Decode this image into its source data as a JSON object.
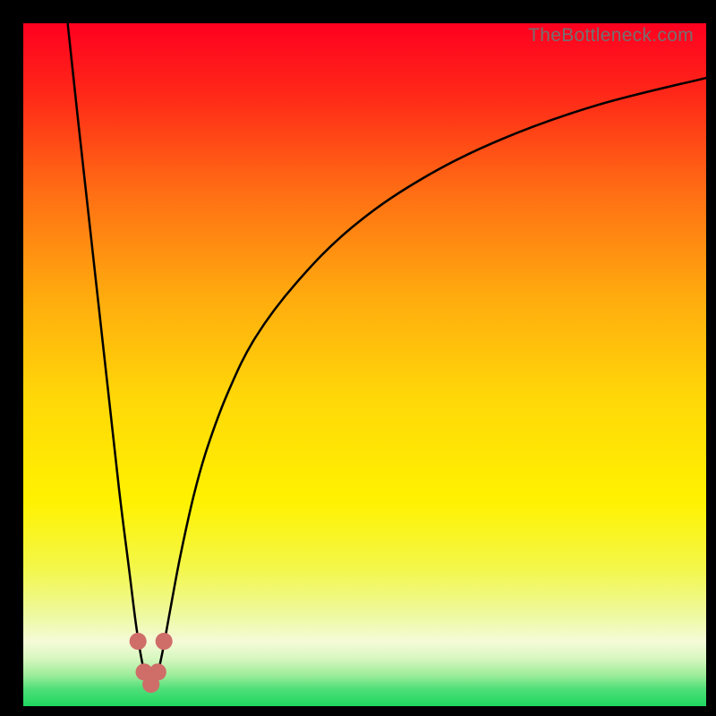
{
  "watermark": "TheBottleneck.com",
  "chart_data": {
    "type": "line",
    "title": "",
    "xlabel": "",
    "ylabel": "",
    "xlim": [
      0,
      100
    ],
    "ylim": [
      0,
      100
    ],
    "grid": false,
    "legend": false,
    "background": "rainbow-vertical-gradient",
    "gradient_stops": [
      {
        "pos": 0.0,
        "color": "#ff0020"
      },
      {
        "pos": 0.1,
        "color": "#ff2618"
      },
      {
        "pos": 0.25,
        "color": "#ff6f14"
      },
      {
        "pos": 0.4,
        "color": "#ffab0e"
      },
      {
        "pos": 0.55,
        "color": "#ffd808"
      },
      {
        "pos": 0.7,
        "color": "#fff200"
      },
      {
        "pos": 0.8,
        "color": "#f3f74c"
      },
      {
        "pos": 0.87,
        "color": "#eef9a4"
      },
      {
        "pos": 0.905,
        "color": "#f5fbd8"
      },
      {
        "pos": 0.93,
        "color": "#d8f7c0"
      },
      {
        "pos": 0.955,
        "color": "#9cec99"
      },
      {
        "pos": 0.975,
        "color": "#4fdf78"
      },
      {
        "pos": 1.0,
        "color": "#1ed760"
      }
    ],
    "series": [
      {
        "name": "bottleneck-curve",
        "color": "#000000",
        "x": [
          6.5,
          8,
          10,
          12,
          14,
          15.5,
          16.5,
          17.3,
          18,
          18.7,
          19.5,
          20.4,
          21.5,
          23,
          25,
          27,
          30,
          34,
          40,
          48,
          58,
          70,
          84,
          100
        ],
        "values": [
          100,
          86,
          68,
          50,
          32,
          20,
          12,
          7,
          4,
          3.2,
          4.2,
          8,
          14,
          22,
          31,
          38,
          46,
          54,
          62,
          70,
          77,
          83,
          88,
          92
        ]
      }
    ],
    "markers": [
      {
        "name": "min-left-upper",
        "x": 16.8,
        "y": 9.5,
        "color": "#cf6d69"
      },
      {
        "name": "min-left-lower",
        "x": 17.7,
        "y": 5.0,
        "color": "#cf6d69"
      },
      {
        "name": "min-bottom",
        "x": 18.7,
        "y": 3.2,
        "color": "#cf6d69"
      },
      {
        "name": "min-right-lower",
        "x": 19.7,
        "y": 5.0,
        "color": "#cf6d69"
      },
      {
        "name": "min-right-upper",
        "x": 20.6,
        "y": 9.5,
        "color": "#cf6d69"
      }
    ]
  }
}
